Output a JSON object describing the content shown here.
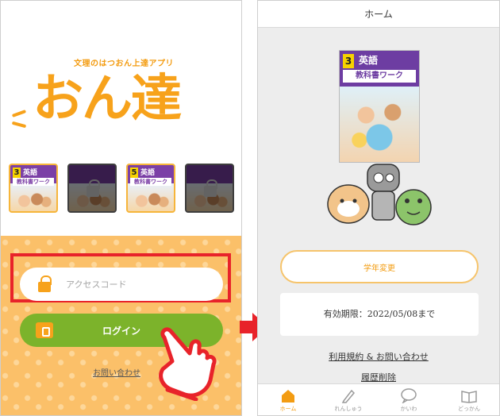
{
  "left_screen": {
    "tagline": "文理のはつおん上達アプリ",
    "logo": "おん達",
    "books": [
      {
        "grade": "3",
        "subject": "英語",
        "band": "教科書ワーク",
        "locked": false
      },
      {
        "grade": "",
        "subject": "",
        "band": "",
        "locked": true
      },
      {
        "grade": "5",
        "subject": "英語",
        "band": "教科書ワーク",
        "locked": false
      },
      {
        "grade": "",
        "subject": "",
        "band": "",
        "locked": true
      }
    ],
    "access_code": {
      "placeholder": "アクセスコード",
      "value": ""
    },
    "login_label": "ログイン",
    "contact_link": "お問い合わせ"
  },
  "right_screen": {
    "title": "ホーム",
    "book": {
      "grade": "3",
      "subject": "英語",
      "title": "教科書ワーク"
    },
    "grade_change_label": "学年変更",
    "expiry_text": "有効期限：2022/05/08まで",
    "terms_link": "利用規約 & お問い合わせ",
    "delete_link": "履歴削除",
    "tabs": [
      {
        "label": "ホーム",
        "icon": "home-icon",
        "active": true
      },
      {
        "label": "れんしゅう",
        "icon": "pencil-icon",
        "active": false
      },
      {
        "label": "かいわ",
        "icon": "chat-icon",
        "active": false
      },
      {
        "label": "どっかん",
        "icon": "book-icon",
        "active": false
      }
    ]
  },
  "colors": {
    "brand_orange": "#f7a21b",
    "login_green": "#7cb32b",
    "highlight_red": "#e8232a"
  }
}
